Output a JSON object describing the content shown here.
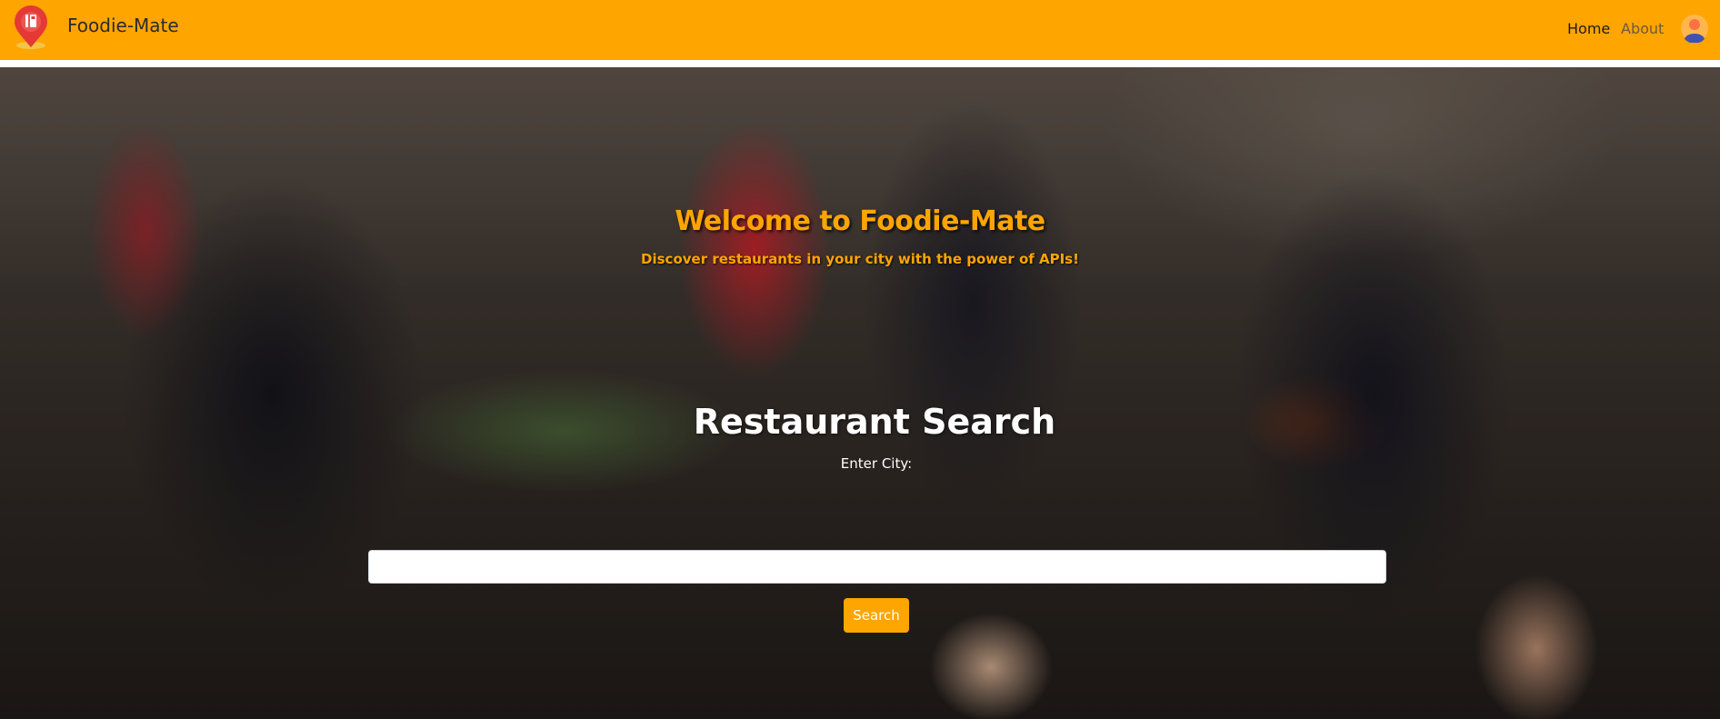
{
  "navbar": {
    "brand": "Foodie-Mate",
    "links": [
      {
        "label": "Home"
      },
      {
        "label": "About"
      }
    ],
    "accent_color": "#ffa500"
  },
  "hero": {
    "welcome_title": "Welcome to Foodie-Mate",
    "tagline": "Discover restaurants in your city with the power of APIs!",
    "search_title": "Restaurant Search",
    "city_label": "Enter City:",
    "city_input_value": "",
    "search_button": "Search"
  },
  "icons": {
    "logo": "location-pin-food-icon",
    "avatar": "user-avatar-icon"
  }
}
